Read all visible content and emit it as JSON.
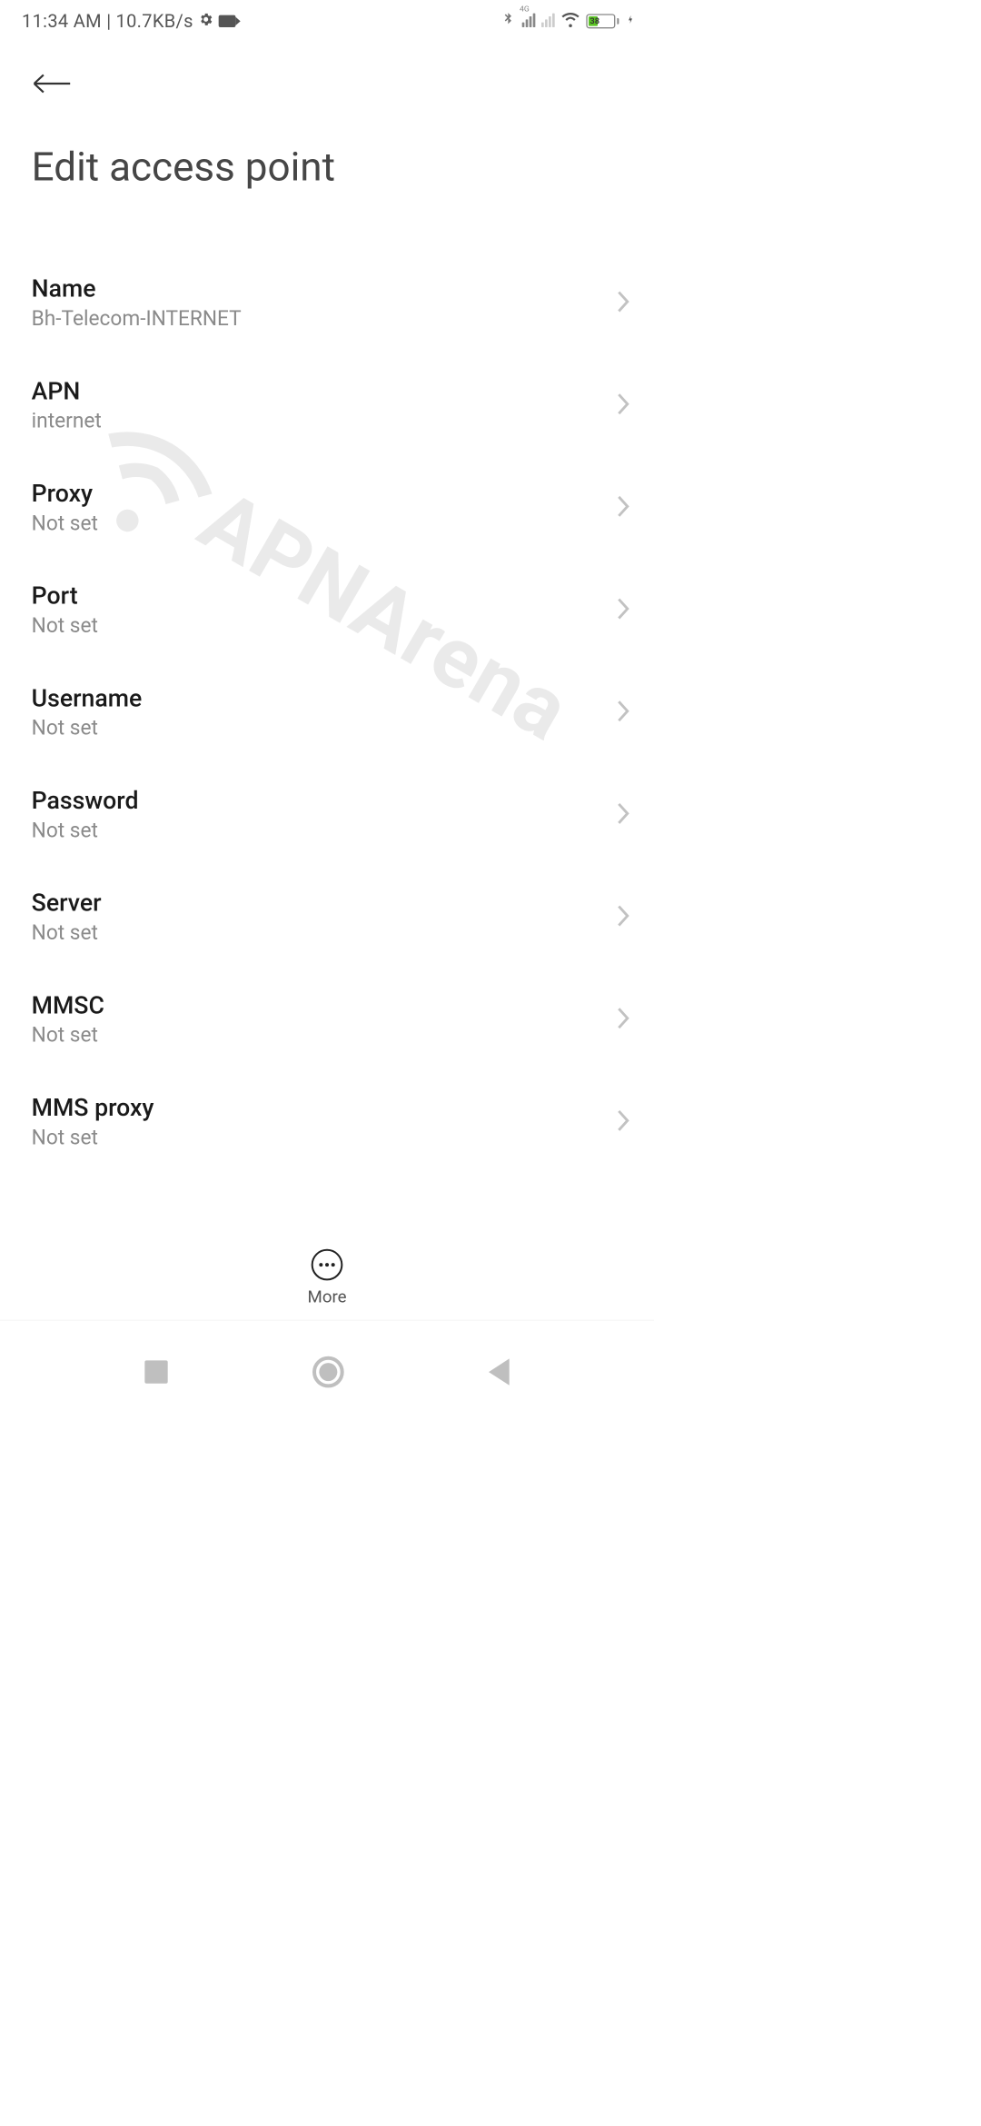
{
  "status_bar": {
    "time": "11:34 AM",
    "separator": "|",
    "data_rate": "10.7KB/s",
    "network_label": "4G",
    "battery_percent": "38"
  },
  "header": {
    "title": "Edit access point"
  },
  "settings": [
    {
      "label": "Name",
      "value": "Bh-Telecom-INTERNET"
    },
    {
      "label": "APN",
      "value": "internet"
    },
    {
      "label": "Proxy",
      "value": "Not set"
    },
    {
      "label": "Port",
      "value": "Not set"
    },
    {
      "label": "Username",
      "value": "Not set"
    },
    {
      "label": "Password",
      "value": "Not set"
    },
    {
      "label": "Server",
      "value": "Not set"
    },
    {
      "label": "MMSC",
      "value": "Not set"
    },
    {
      "label": "MMS proxy",
      "value": "Not set"
    }
  ],
  "bottom_action": {
    "more": "More"
  },
  "watermark": {
    "text": "APNArena"
  }
}
